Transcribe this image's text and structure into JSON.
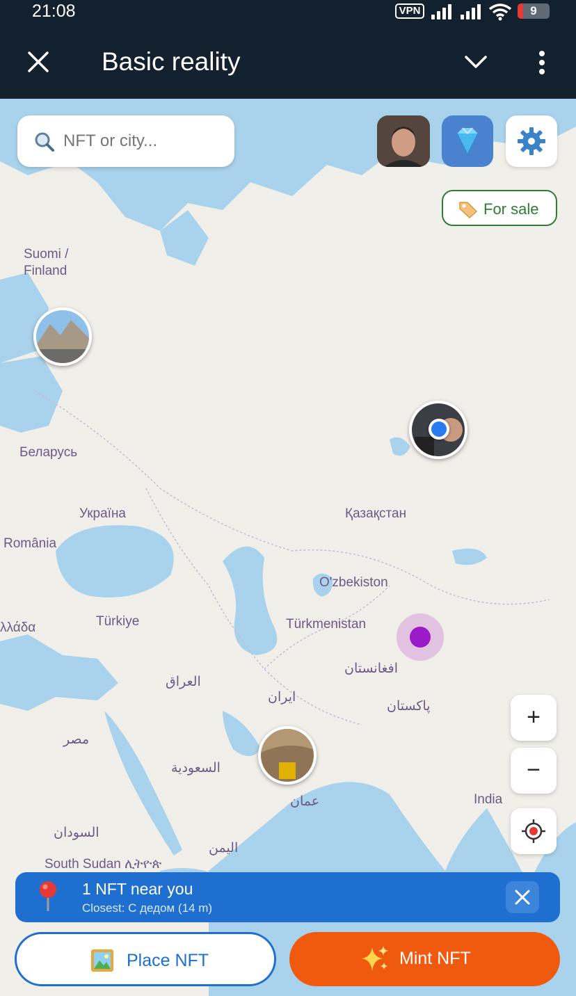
{
  "status_bar": {
    "time": "21:08",
    "vpn_label": "VPN",
    "battery_level": "9",
    "icons": [
      "signal-icon",
      "wifi-icon",
      "battery-icon"
    ]
  },
  "app_bar": {
    "title": "Basic reality",
    "icons": [
      "close-icon",
      "chevron-down-icon",
      "more-vert-icon"
    ]
  },
  "search": {
    "placeholder": "NFT or city..."
  },
  "top_buttons": {
    "profile_icon": "avatar",
    "premium_icon": "diamond-icon",
    "settings_icon": "gear-icon"
  },
  "filter": {
    "for_sale_label": "For sale"
  },
  "map_labels": {
    "finland": "Suomi /\nFinland",
    "belarus": "Беларусь",
    "ukraine": "Україна",
    "romania": "România",
    "greece": "λλάδα",
    "turkey": "Türkiye",
    "iraq": "العراق",
    "iran": "ايران",
    "kazakhstan": "Қазақстан",
    "uzbekistan": "O'zbekiston",
    "turkmenistan": "Türkmenistan",
    "afghanistan": "افغانستان",
    "pakistan": "پاکستان",
    "egypt": "مصر",
    "saudi": "السعودية",
    "oman": "عمان",
    "india": "India",
    "sudan": "السودان",
    "yemen": "اليمن",
    "south_sudan": "South Sudan ሊትዮጵ"
  },
  "map_controls": {
    "zoom_in": "+",
    "zoom_out": "−"
  },
  "nearby_banner": {
    "headline": "1 NFT near you",
    "subtitle": "Closest: С дедом (14 m)"
  },
  "actions": {
    "place_label": "Place NFT",
    "mint_label": "Mint NFT"
  },
  "colors": {
    "app_bar": "#13202e",
    "map_land": "#f1efea",
    "map_water": "#a9d3ec",
    "accent_blue": "#1e6fd0",
    "accent_orange": "#ef5a0f",
    "sale_green": "#2e7d32",
    "user_location": "#2a7bf0",
    "nft_purple": "#9c1bc8"
  }
}
